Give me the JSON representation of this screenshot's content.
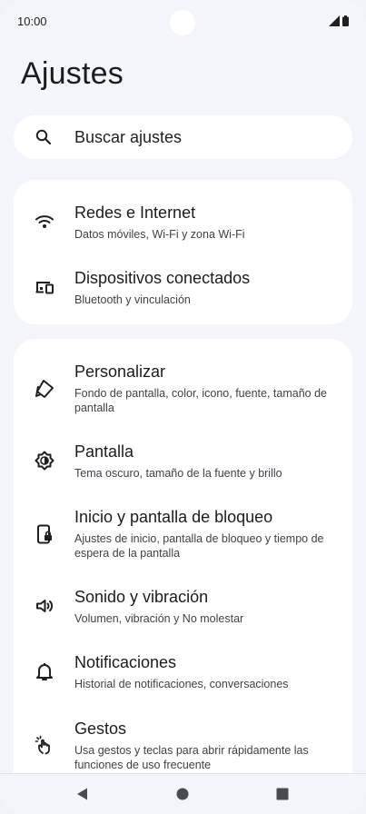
{
  "status_bar": {
    "time": "10:00"
  },
  "page": {
    "title": "Ajustes"
  },
  "search": {
    "placeholder": "Buscar ajustes"
  },
  "groups": [
    {
      "items": [
        {
          "icon": "wifi-icon",
          "title": "Redes e Internet",
          "subtitle": "Datos móviles, Wi-Fi y zona Wi-Fi"
        },
        {
          "icon": "devices-icon",
          "title": "Dispositivos conectados",
          "subtitle": "Bluetooth y vinculación"
        }
      ]
    },
    {
      "items": [
        {
          "icon": "palette-icon",
          "title": "Personalizar",
          "subtitle": "Fondo de pantalla, color, icono, fuente, tamaño de pantalla"
        },
        {
          "icon": "brightness-icon",
          "title": "Pantalla",
          "subtitle": "Tema oscuro, tamaño de la fuente y brillo"
        },
        {
          "icon": "lock-screen-icon",
          "title": "Inicio y pantalla de bloqueo",
          "subtitle": "Ajustes de inicio, pantalla de bloqueo y tiempo de espera de la pantalla"
        },
        {
          "icon": "volume-icon",
          "title": "Sonido y vibración",
          "subtitle": "Volumen, vibración y No molestar"
        },
        {
          "icon": "bell-icon",
          "title": "Notificaciones",
          "subtitle": "Historial de notificaciones, conversaciones"
        },
        {
          "icon": "gesture-icon",
          "title": "Gestos",
          "subtitle": "Usa gestos y teclas para abrir rápidamente las funciones de uso frecuente"
        }
      ]
    }
  ],
  "navigation": {
    "back": "back-icon",
    "home": "home-icon",
    "recents": "recents-icon"
  },
  "colors": {
    "background": "#f4f5fa",
    "card": "#ffffff",
    "text": "#1b1c1e",
    "subtext": "#3f4147"
  }
}
